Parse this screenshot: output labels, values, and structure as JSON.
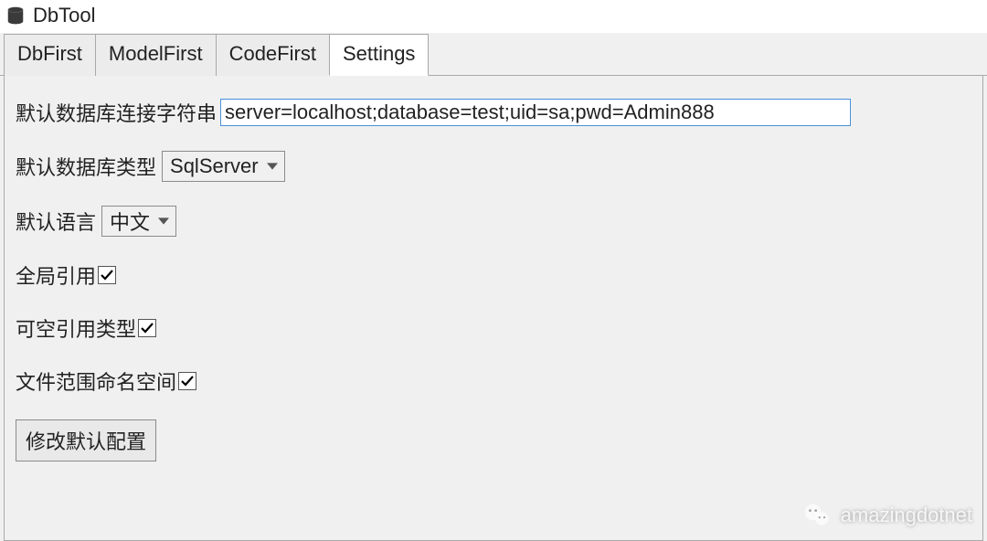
{
  "app": {
    "title": "DbTool"
  },
  "tabs": [
    {
      "label": "DbFirst",
      "active": false
    },
    {
      "label": "ModelFirst",
      "active": false
    },
    {
      "label": "CodeFirst",
      "active": false
    },
    {
      "label": "Settings",
      "active": true
    }
  ],
  "settings": {
    "conn_label": "默认数据库连接字符串",
    "conn_value": "server=localhost;database=test;uid=sa;pwd=Admin888",
    "dbtype_label": "默认数据库类型",
    "dbtype_value": "SqlServer",
    "lang_label": "默认语言",
    "lang_value": "中文",
    "global_ref_label": "全局引用",
    "global_ref_checked": true,
    "nullable_ref_label": "可空引用类型",
    "nullable_ref_checked": true,
    "file_ns_label": "文件范围命名空间",
    "file_ns_checked": true,
    "save_button": "修改默认配置"
  },
  "watermark": {
    "text": "amazingdotnet"
  }
}
